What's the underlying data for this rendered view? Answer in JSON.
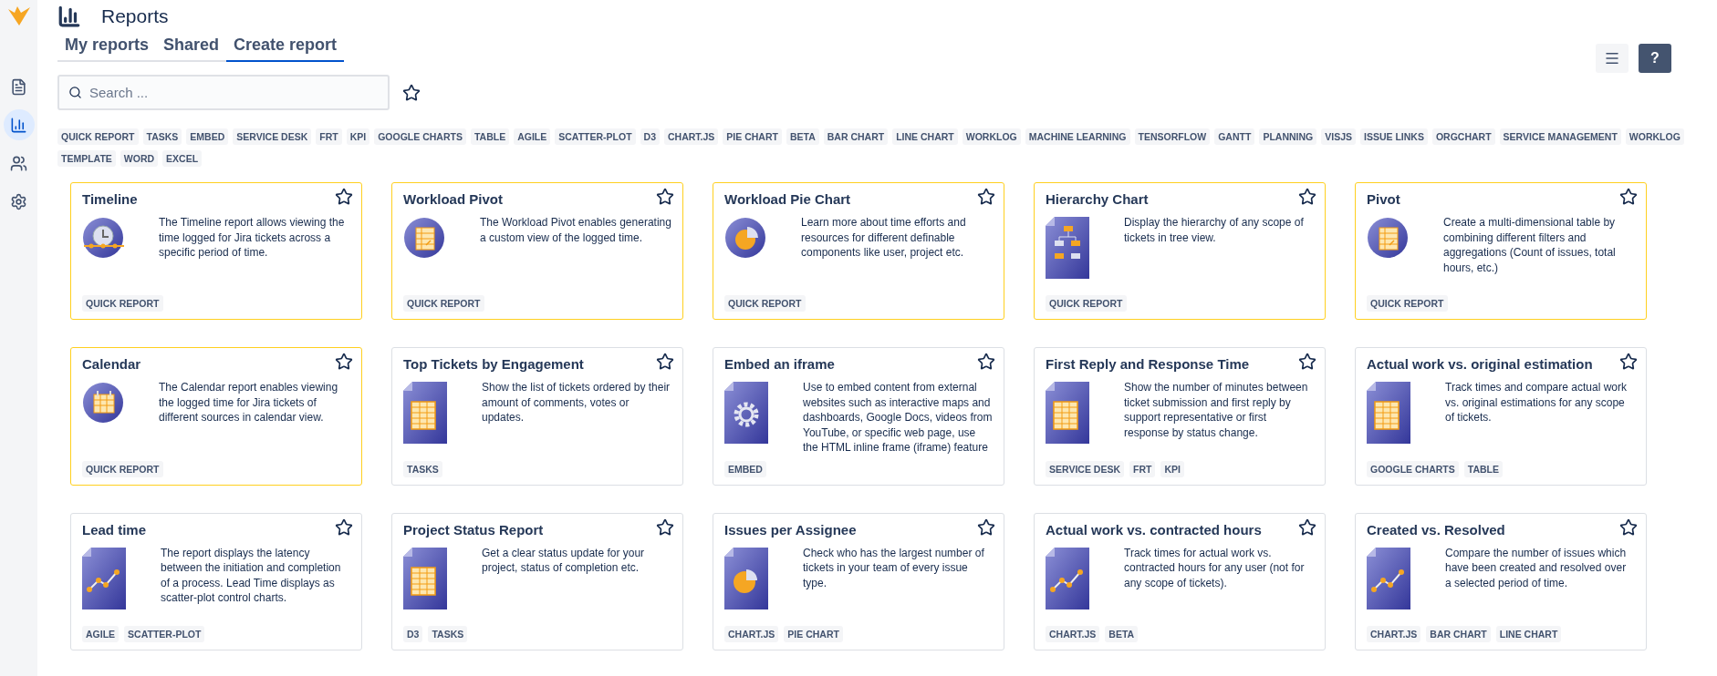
{
  "sidebar": {
    "items": [
      {
        "kind": "document",
        "selected": false
      },
      {
        "kind": "chart",
        "selected": true
      },
      {
        "kind": "people",
        "selected": false
      },
      {
        "kind": "settings",
        "selected": false
      }
    ]
  },
  "header": {
    "title": "Reports"
  },
  "tabs": [
    {
      "label": "My reports",
      "selected": false
    },
    {
      "label": "Shared",
      "selected": false
    },
    {
      "label": "Create report",
      "selected": true
    }
  ],
  "toolbar": {
    "help_label": "?"
  },
  "search": {
    "placeholder": "Search ..."
  },
  "tags": [
    "QUICK REPORT",
    "TASKS",
    "EMBED",
    "SERVICE DESK",
    "FRT",
    "KPI",
    "GOOGLE CHARTS",
    "TABLE",
    "AGILE",
    "SCATTER-PLOT",
    "D3",
    "CHART.JS",
    "PIE CHART",
    "BETA",
    "BAR CHART",
    "LINE CHART",
    "WORKLOG",
    "MACHINE LEARNING",
    "TENSORFLOW",
    "GANTT",
    "PLANNING",
    "VISJS",
    "ISSUE LINKS",
    "ORGCHART",
    "SERVICE MANAGEMENT",
    "WORKLOG",
    "TEMPLATE",
    "WORD",
    "EXCEL"
  ],
  "cards": [
    {
      "title": "Timeline",
      "description": "The Timeline report allows viewing the time logged for Jira tickets across a specific period of time.",
      "kind": "clock",
      "highlighted": true,
      "tags": [
        "QUICK REPORT"
      ]
    },
    {
      "title": "Workload Pivot",
      "description": "The Workload Pivot enables generating a custom view of the logged time.",
      "kind": "pivot",
      "highlighted": true,
      "tags": [
        "QUICK REPORT"
      ]
    },
    {
      "title": "Workload Pie Chart",
      "description": "Learn more about time efforts and resources for different definable components like user, project etc.",
      "kind": "pie",
      "highlighted": true,
      "tags": [
        "QUICK REPORT"
      ]
    },
    {
      "title": "Hierarchy Chart",
      "description": "Display the hierarchy of any scope of tickets in tree view.",
      "kind": "hierarchy",
      "highlighted": true,
      "tags": [
        "QUICK REPORT"
      ]
    },
    {
      "title": "Pivot",
      "description": "Create a multi-dimensional table by combining different filters and aggregations (Count of issues, total hours, etc.)",
      "kind": "pivot",
      "highlighted": true,
      "tags": [
        "QUICK REPORT"
      ]
    },
    {
      "title": "Calendar",
      "description": "The Calendar report enables viewing the logged time for Jira tickets of different sources in calendar view.",
      "kind": "calendar",
      "highlighted": true,
      "tags": [
        "QUICK REPORT"
      ]
    },
    {
      "title": "Top Tickets by Engagement",
      "description": "Show the list of tickets ordered by their amount of comments, votes or updates.",
      "kind": "table",
      "highlighted": false,
      "tags": [
        "TASKS"
      ]
    },
    {
      "title": "Embed an iframe",
      "description": "Use to embed content from external websites such as interactive maps and dashboards, Google Docs, videos from YouTube, or specific web page, use the HTML inline frame (iframe) feature",
      "kind": "gear",
      "highlighted": false,
      "tags": [
        "EMBED"
      ]
    },
    {
      "title": "First Reply and Response Time",
      "description": "Show the number of minutes between ticket submission and first reply by support representative or first response by status change.",
      "kind": "table",
      "highlighted": false,
      "tags": [
        "SERVICE DESK",
        "FRT",
        "KPI"
      ]
    },
    {
      "title": "Actual work vs. original estimation",
      "description": "Track times and compare actual work vs. original estimations for any scope of tickets.",
      "kind": "table",
      "highlighted": false,
      "tags": [
        "GOOGLE CHARTS",
        "TABLE"
      ]
    },
    {
      "title": "Lead time",
      "description": "The report displays the latency between the initiation and completion of a process. Lead Time displays as scatter-plot control charts.",
      "kind": "line",
      "highlighted": false,
      "tags": [
        "AGILE",
        "SCATTER-PLOT"
      ]
    },
    {
      "title": "Project Status Report",
      "description": "Get a clear status update for your project, status of completion etc.",
      "kind": "table",
      "highlighted": false,
      "tags": [
        "D3",
        "TASKS"
      ]
    },
    {
      "title": "Issues per Assignee",
      "description": "Check who has the largest number of tickets in your team of every issue type.",
      "kind": "piedoc",
      "highlighted": false,
      "tags": [
        "CHART.JS",
        "PIE CHART"
      ]
    },
    {
      "title": "Actual work vs. contracted hours",
      "description": "Track times for actual work vs. contracted hours for any user (not for any scope of tickets).",
      "kind": "line",
      "highlighted": false,
      "tags": [
        "CHART.JS",
        "BETA"
      ]
    },
    {
      "title": "Created vs. Resolved",
      "description": "Compare the number of issues which have been created and resolved over a selected period of time.",
      "kind": "line",
      "highlighted": false,
      "tags": [
        "CHART.JS",
        "BAR CHART",
        "LINE CHART"
      ]
    }
  ]
}
